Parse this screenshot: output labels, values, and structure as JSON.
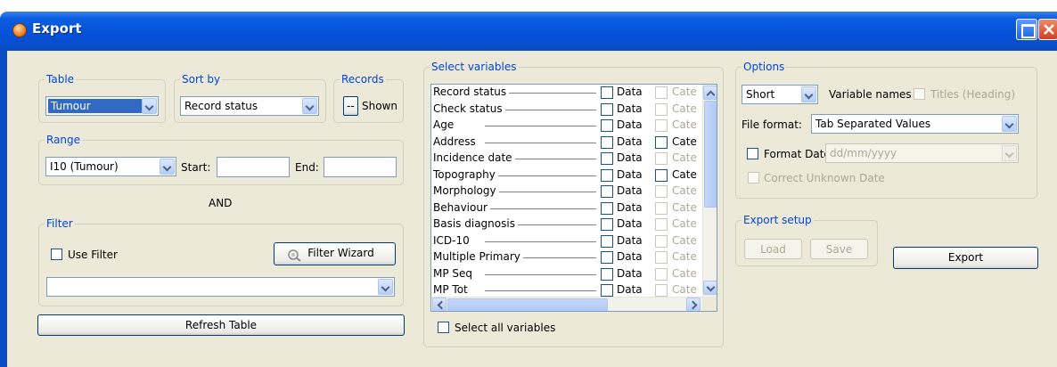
{
  "window": {
    "title": "Export"
  },
  "table_group": {
    "legend": "Table",
    "value": "Tumour"
  },
  "sort_group": {
    "legend": "Sort by",
    "value": "Record status"
  },
  "records_group": {
    "legend": "Records",
    "button": "--",
    "shown_label": "Shown"
  },
  "range_group": {
    "legend": "Range",
    "value": "I10 (Tumour)",
    "start_label": "Start:",
    "start_value": "",
    "end_label": "End:",
    "end_value": ""
  },
  "and_label": "AND",
  "filter_group": {
    "legend": "Filter",
    "use_filter_label": "Use Filter",
    "use_filter_checked": false,
    "wizard_button": "Filter Wizard",
    "filter_value": ""
  },
  "refresh_button": "Refresh Table",
  "variables_group": {
    "legend": "Select variables",
    "data_label": "Data",
    "cate_label": "Cate",
    "rows": [
      {
        "name": "Record status",
        "cate_enabled": false
      },
      {
        "name": "Check status",
        "cate_enabled": false
      },
      {
        "name": "Age",
        "cate_enabled": false
      },
      {
        "name": "Address",
        "cate_enabled": true
      },
      {
        "name": "Incidence date",
        "cate_enabled": false
      },
      {
        "name": "Topography",
        "cate_enabled": true
      },
      {
        "name": "Morphology",
        "cate_enabled": false
      },
      {
        "name": "Behaviour",
        "cate_enabled": false
      },
      {
        "name": "Basis diagnosis",
        "cate_enabled": false
      },
      {
        "name": "ICD-10",
        "cate_enabled": false
      },
      {
        "name": "Multiple Primary",
        "cate_enabled": false
      },
      {
        "name": "MP Seq",
        "cate_enabled": false
      },
      {
        "name": "MP Tot",
        "cate_enabled": false
      }
    ],
    "select_all_label": "Select all variables"
  },
  "options_group": {
    "legend": "Options",
    "name_style_value": "Short",
    "variable_names_label": "Variable names",
    "titles_label": "Titles (Heading)",
    "file_format_label": "File format:",
    "file_format_value": "Tab Separated Values",
    "format_date_label": "Format Date",
    "date_format_value": "dd/mm/yyyy",
    "correct_unknown_label": "Correct Unknown Date"
  },
  "export_setup_group": {
    "legend": "Export setup",
    "load_button": "Load",
    "save_button": "Save"
  },
  "export_button": "Export"
}
